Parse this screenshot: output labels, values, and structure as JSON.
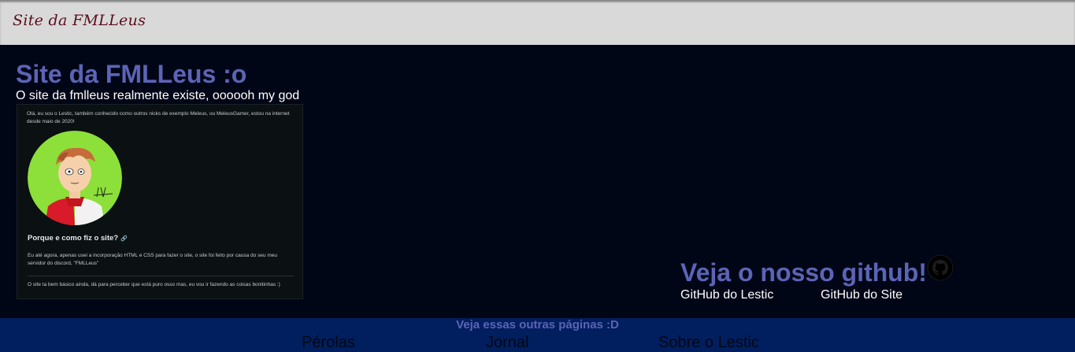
{
  "header": {
    "brand": "Site da FMLLeus"
  },
  "hero": {
    "title": "Site da FMLLeus :o",
    "subtitle": "O site da fmlleus realmente existe, oooooh my god"
  },
  "preview": {
    "intro": "Olá, eu sou o Lestic, também conhecido como outros nicks de exemplo Meleus, ou MeleusGamer, estou na internet desde maio de 2020!",
    "heading": "Porque e como fiz o site?",
    "link_icon": "link-icon",
    "body": "Eu até agora, apenas usei a incorporação HTML e CSS para fazer o site, o site foi feito por causa do seu meu servidor do discord, \"FMLLeus\"",
    "footer": "O site ta bem básico ainda, dá para perceber que está puro osso mas, eu vou ir fazendo as coisas bonitinhas :)"
  },
  "github": {
    "title": "Veja o nosso github!",
    "icon": "github-icon",
    "links": [
      "GitHub do Lestic",
      "GitHub do Site"
    ]
  },
  "footer": {
    "title": "Veja essas outras páginas :D",
    "links": [
      "Pérolas",
      "Jornal",
      "Sobre o Lestic"
    ]
  },
  "colors": {
    "background": "#010617",
    "header_bg": "#d9d9d9",
    "brand": "#5a0d1d",
    "accent": "#5b64b5",
    "footer_bg": "#011e5e"
  }
}
